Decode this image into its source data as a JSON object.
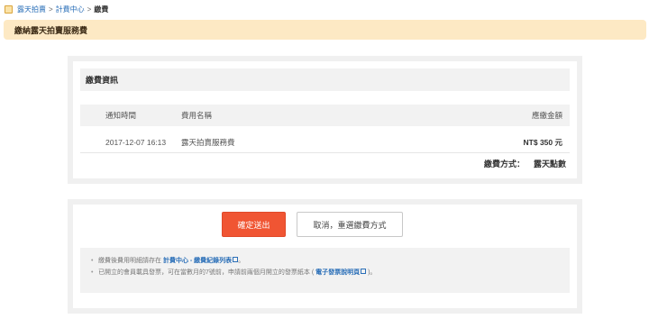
{
  "breadcrumb": {
    "home": "露天拍賣",
    "sep1": ">",
    "billing": "計費中心",
    "sep2": ">",
    "current": "繳費"
  },
  "page_title": "繳納露天拍賣服務費",
  "payment_info": {
    "heading": "繳費資訊",
    "columns": {
      "date": "通知時間",
      "name": "費用名稱",
      "amount": "應繳金額"
    },
    "row": {
      "date": "2017-12-07 16:13",
      "name": "露天拍賣服務費",
      "amount": "NT$ 350 元"
    },
    "method_label": "繳費方式：",
    "method_value": "露天點數"
  },
  "actions": {
    "submit_label": "確定送出",
    "cancel_label": "取消，重選繳費方式"
  },
  "notes": {
    "line1_prefix": "繳費後費用明細請存在 ",
    "line1_link": "計費中心 - 繳費紀錄列表",
    "line1_suffix": "。",
    "line2_prefix": "已開立的會員載具發票，可在當數月的7號前，申請前兩個月開立的發票紙本 ( ",
    "line2_link": "電子發票說明頁",
    "line2_suffix": " )。"
  },
  "icons": {
    "home": "home-icon",
    "external": "external-link-icon"
  },
  "colors": {
    "accent": "#f05533",
    "title_bg": "#fde9c4",
    "link": "#2a6fb8"
  }
}
